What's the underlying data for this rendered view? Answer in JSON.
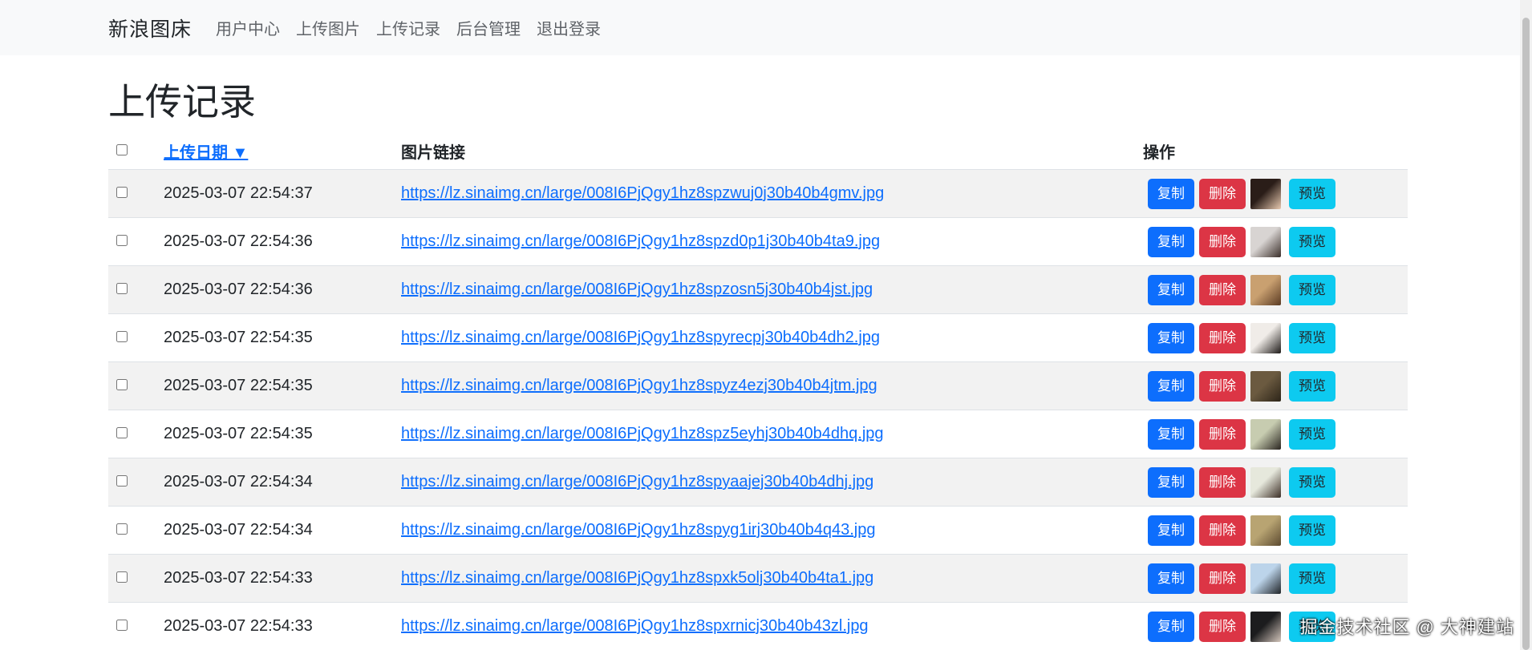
{
  "navbar": {
    "brand": "新浪图床",
    "links": [
      "用户中心",
      "上传图片",
      "上传记录",
      "后台管理",
      "退出登录"
    ]
  },
  "page": {
    "title": "上传记录"
  },
  "table": {
    "headers": {
      "date": "上传日期 ▼",
      "link": "图片链接",
      "actions": "操作"
    },
    "actions": {
      "copy": "复制",
      "delete": "删除",
      "preview": "预览"
    },
    "rows": [
      {
        "date": "2025-03-07 22:54:37",
        "url": "https://lz.sinaimg.cn/large/008I6PjQgy1hz8spzwuj0j30b40b4gmv.jpg",
        "thumb_colors": [
          "#2a1d18",
          "#e8c9b0"
        ]
      },
      {
        "date": "2025-03-07 22:54:36",
        "url": "https://lz.sinaimg.cn/large/008I6PjQgy1hz8spzd0p1j30b40b4ta9.jpg",
        "thumb_colors": [
          "#d8d4d2",
          "#3a2e2a"
        ]
      },
      {
        "date": "2025-03-07 22:54:36",
        "url": "https://lz.sinaimg.cn/large/008I6PjQgy1hz8spzosn5j30b40b4jst.jpg",
        "thumb_colors": [
          "#c9a070",
          "#5a3a22"
        ]
      },
      {
        "date": "2025-03-07 22:54:35",
        "url": "https://lz.sinaimg.cn/large/008I6PjQgy1hz8spyrecpj30b40b4dh2.jpg",
        "thumb_colors": [
          "#f0ece8",
          "#1e1a18"
        ]
      },
      {
        "date": "2025-03-07 22:54:35",
        "url": "https://lz.sinaimg.cn/large/008I6PjQgy1hz8spyz4ezj30b40b4jtm.jpg",
        "thumb_colors": [
          "#6b5a40",
          "#2c2418"
        ]
      },
      {
        "date": "2025-03-07 22:54:35",
        "url": "https://lz.sinaimg.cn/large/008I6PjQgy1hz8spz5eyhj30b40b4dhq.jpg",
        "thumb_colors": [
          "#c7ccb0",
          "#2a2520"
        ]
      },
      {
        "date": "2025-03-07 22:54:34",
        "url": "https://lz.sinaimg.cn/large/008I6PjQgy1hz8spyaajej30b40b4dhj.jpg",
        "thumb_colors": [
          "#e6e8dc",
          "#3c2e26"
        ]
      },
      {
        "date": "2025-03-07 22:54:34",
        "url": "https://lz.sinaimg.cn/large/008I6PjQgy1hz8spyg1irj30b40b4q43.jpg",
        "thumb_colors": [
          "#b8a472",
          "#5c4a30"
        ]
      },
      {
        "date": "2025-03-07 22:54:33",
        "url": "https://lz.sinaimg.cn/large/008I6PjQgy1hz8spxk5olj30b40b4ta1.jpg",
        "thumb_colors": [
          "#bcd4ea",
          "#202428"
        ]
      },
      {
        "date": "2025-03-07 22:54:33",
        "url": "https://lz.sinaimg.cn/large/008I6PjQgy1hz8spxrnicj30b40b43zl.jpg",
        "thumb_colors": [
          "#1c1c1e",
          "#d4c6bc"
        ]
      }
    ]
  },
  "watermark": "掘金技术社区 @ 大神建站",
  "colors": {
    "primary": "#0d6efd",
    "danger": "#dc3545",
    "info": "#0dcaf0",
    "navbar_bg": "#f8f9fa",
    "stripe_bg": "#f2f2f2"
  }
}
